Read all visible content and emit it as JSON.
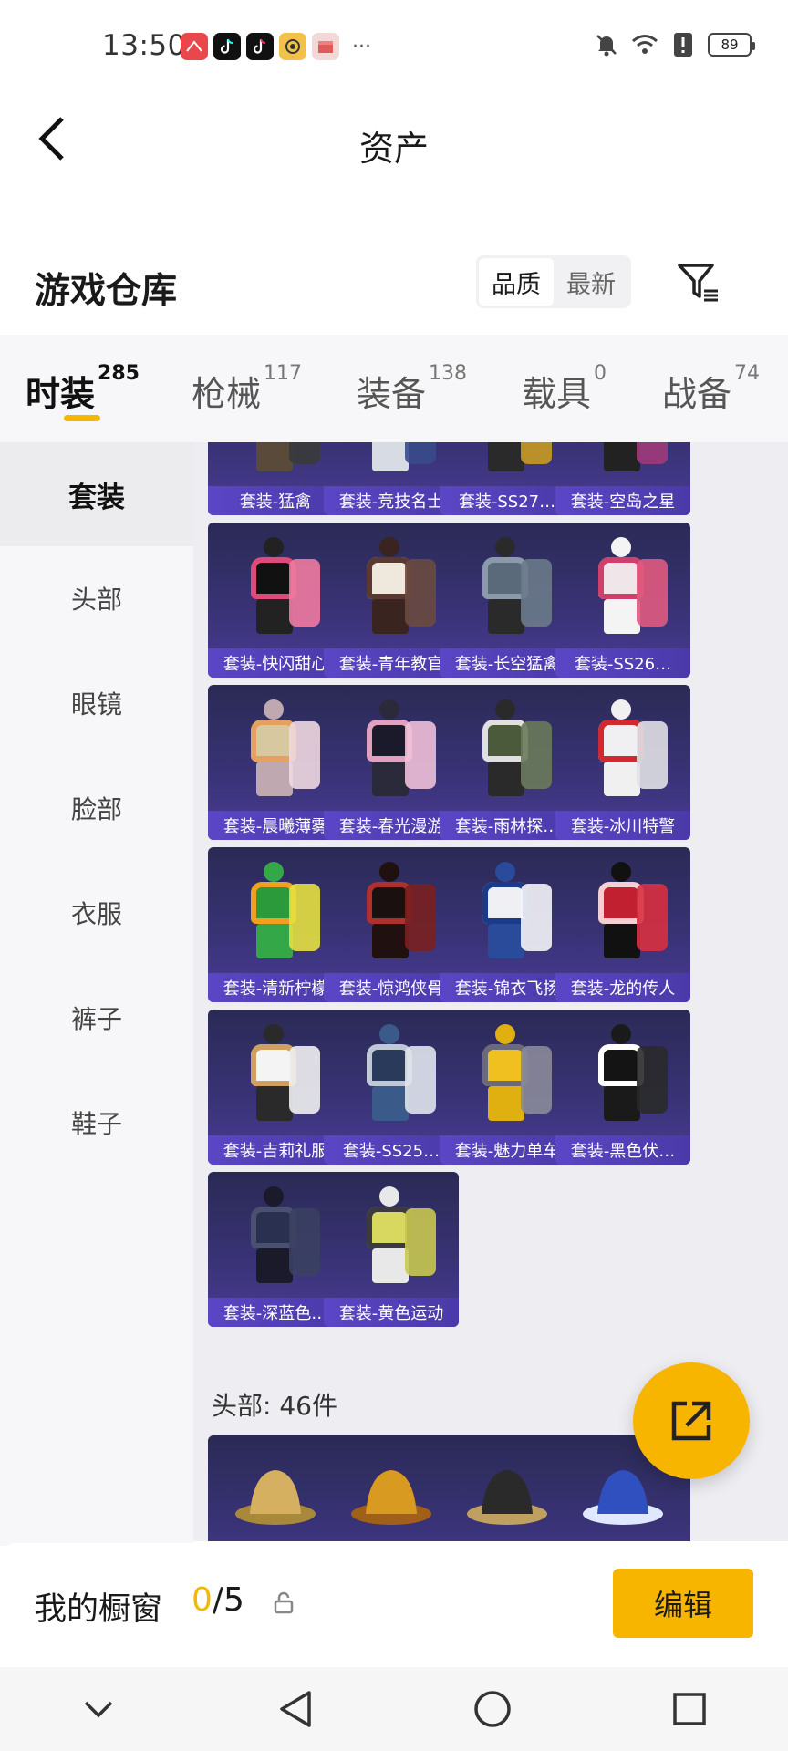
{
  "status_bar": {
    "time": "13:50",
    "notification_icons": [
      "huawei-app-icon",
      "tiktok-icon",
      "tiktok-icon",
      "game-app-icon",
      "gift-app-icon"
    ],
    "more": "···",
    "battery": "89"
  },
  "header": {
    "title": "资产"
  },
  "warehouse": {
    "title": "游戏仓库",
    "sort_options": [
      "品质",
      "最新"
    ],
    "active_sort": "品质"
  },
  "tabs": [
    {
      "label": "时装",
      "count": "285",
      "active": true
    },
    {
      "label": "枪械",
      "count": "117"
    },
    {
      "label": "装备",
      "count": "138"
    },
    {
      "label": "载具",
      "count": "0"
    },
    {
      "label": "战备",
      "count": "74"
    }
  ],
  "sidebar": [
    {
      "label": "套装",
      "active": true
    },
    {
      "label": "头部"
    },
    {
      "label": "眼镜"
    },
    {
      "label": "脸部"
    },
    {
      "label": "衣服"
    },
    {
      "label": "裤子"
    },
    {
      "label": "鞋子"
    }
  ],
  "suits": [
    {
      "label": "套装-猛禽"
    },
    {
      "label": "套装-竞技名士"
    },
    {
      "label": "套装-SS27…"
    },
    {
      "label": "套装-空岛之星"
    },
    {
      "label": "套装-快闪甜心"
    },
    {
      "label": "套装-青年教官"
    },
    {
      "label": "套装-长空猛禽"
    },
    {
      "label": "套装-SS26…"
    },
    {
      "label": "套装-晨曦薄雾"
    },
    {
      "label": "套装-春光漫游"
    },
    {
      "label": "套装-雨林探…"
    },
    {
      "label": "套装-冰川特警"
    },
    {
      "label": "套装-清新柠檬"
    },
    {
      "label": "套装-惊鸿侠骨"
    },
    {
      "label": "套装-锦衣飞扬"
    },
    {
      "label": "套装-龙的传人"
    },
    {
      "label": "套装-吉莉礼服"
    },
    {
      "label": "套装-SS25…"
    },
    {
      "label": "套装-魅力单车"
    },
    {
      "label": "套装-黑色伏…"
    },
    {
      "label": "套装-深蓝色…"
    },
    {
      "label": "套装-黄色运动"
    }
  ],
  "head_section": {
    "label": "头部: 46件"
  },
  "showcase": {
    "label": "我的橱窗",
    "current": "0",
    "separator": "/",
    "max": "5",
    "edit_label": "编辑"
  },
  "colors": {
    "accent": "#f7b500",
    "card_label_bg": "#5b46c6",
    "card_bg": "#3a3378"
  }
}
